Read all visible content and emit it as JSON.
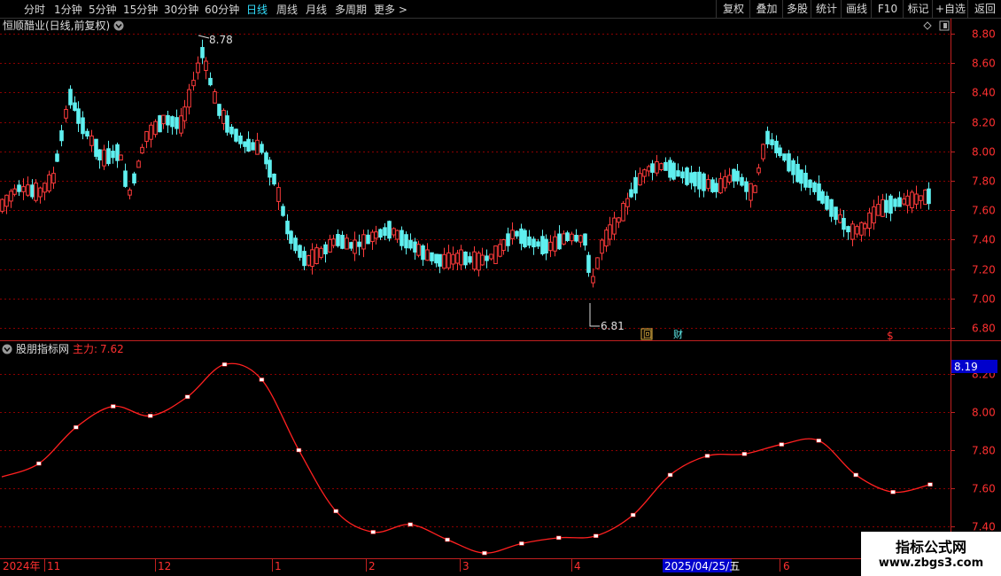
{
  "toolbar": {
    "periods": [
      "分时",
      "1分钟",
      "5分钟",
      "15分钟",
      "30分钟",
      "60分钟",
      "日线",
      "周线",
      "月线",
      "多周期",
      "更多"
    ],
    "active_period": "日线",
    "more_arrow": "chevron-right-icon",
    "actions": [
      "复权",
      "叠加",
      "多股",
      "统计",
      "画线",
      "F10",
      "标记",
      "+自选",
      "返回"
    ]
  },
  "price_panel": {
    "title": "恒顺醋业(日线,前复权)",
    "high_label": "8.78",
    "low_label": "6.81",
    "markers": {
      "hui": "回",
      "cai": "财",
      "dollar": "$"
    },
    "y_ticks": [
      "8.80",
      "8.60",
      "8.40",
      "8.20",
      "8.00",
      "7.80",
      "7.60",
      "7.40",
      "7.20",
      "7.00",
      "6.80"
    ]
  },
  "indicator_panel": {
    "title": "股朋指标网",
    "series_label": "主力:",
    "series_value": "7.62",
    "current_badge": "8.19",
    "y_ticks": [
      "8.20",
      "8.00",
      "7.80",
      "7.60",
      "7.40"
    ]
  },
  "x_axis": {
    "labels": [
      "2024年",
      "11",
      "12",
      "1",
      "2",
      "3",
      "4",
      "2025/04/25/五",
      "6"
    ],
    "cursor_label": "2025/04/25/五"
  },
  "watermark": {
    "line1": "指标公式网",
    "line2": "www.zbgs3.com"
  },
  "colors": {
    "up": "#ff3b3b",
    "down": "#5ff0f0",
    "grid": "#8b0000",
    "axis": "#c02020",
    "indicator_line": "#ff2020",
    "active_tab": "#33e0ff",
    "badge_bg": "#0000cc"
  },
  "chart_data": {
    "type": "line",
    "title": "股朋指标网",
    "series": [
      {
        "name": "主力",
        "values": [
          7.66,
          7.73,
          7.92,
          8.03,
          7.98,
          8.08,
          8.25,
          8.17,
          7.8,
          7.48,
          7.37,
          7.41,
          7.33,
          7.26,
          7.31,
          7.34,
          7.35,
          7.46,
          7.67,
          7.77,
          7.78,
          7.83,
          7.85,
          7.67,
          7.58,
          7.62
        ]
      }
    ],
    "ylim": [
      7.4,
      8.2
    ]
  }
}
